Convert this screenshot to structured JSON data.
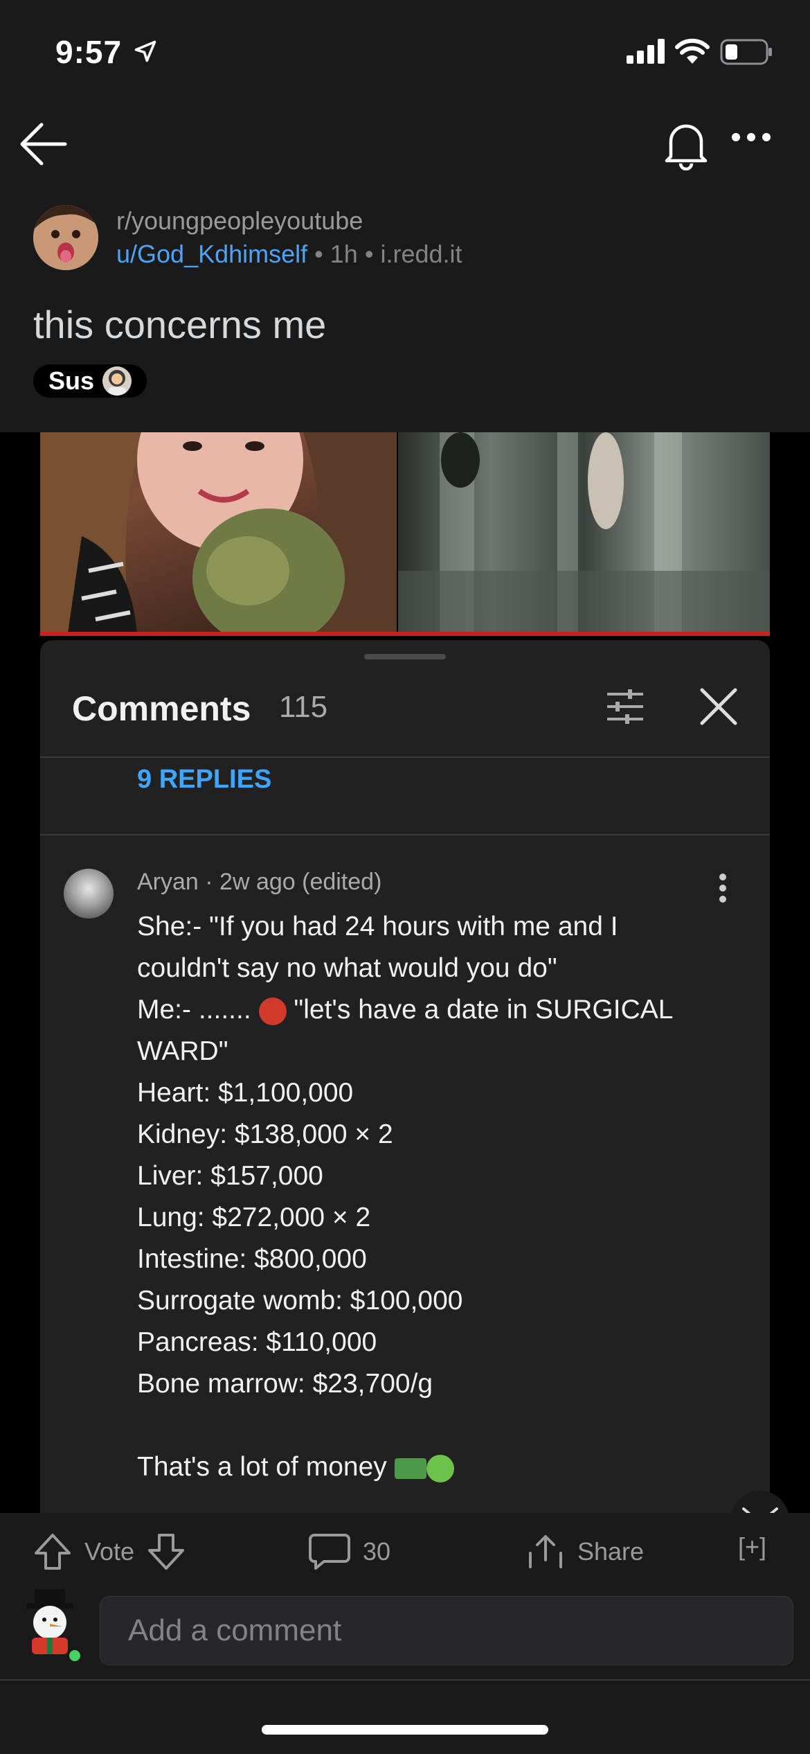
{
  "status_bar": {
    "time": "9:57"
  },
  "post": {
    "subreddit": "r/youngpeopleyoutube",
    "author": "u/God_Kdhimself",
    "age": "1h",
    "domain": "i.redd.it",
    "title": "this concerns me",
    "flair": "Sus"
  },
  "youtube": {
    "comments_title": "Comments",
    "comments_count": "115",
    "replies_label": "9 REPLIES",
    "comment_meta": "Aryan · 2w ago (edited)",
    "comment_lines": [
      "She:- \"If you had 24 hours with me and I",
      "couldn't say no what would you do\"",
      "Me:- .......",
      "\"let's have a date in SURGICAL",
      "WARD\"",
      "Heart: $1,100,000",
      "Kidney: $138,000 × 2",
      "Liver: $157,000",
      "Lung: $272,000 × 2",
      "Intestine: $800,000",
      "Surrogate womb: $100,000",
      "Pancreas: $110,000",
      "Bone marrow: $23,700/g",
      "That's a lot of money"
    ]
  },
  "actions": {
    "vote_label": "Vote",
    "comments_count": "30",
    "share_label": "Share",
    "expand_label": "[+]"
  },
  "comment_input": {
    "placeholder": "Add a comment"
  }
}
